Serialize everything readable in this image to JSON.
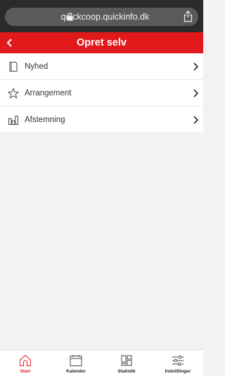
{
  "browser": {
    "url": "quickcoop.quickinfo.dk"
  },
  "header": {
    "title": "Opret selv",
    "color": "#e2191b"
  },
  "menu": {
    "items": [
      {
        "label": "Nyhed",
        "icon": "document-icon"
      },
      {
        "label": "Arrangement",
        "icon": "star-icon"
      },
      {
        "label": "Afstemning",
        "icon": "poll-icon"
      }
    ]
  },
  "tabs": [
    {
      "label": "Start",
      "icon": "home-icon",
      "active": true
    },
    {
      "label": "Kalender",
      "icon": "calendar-icon",
      "active": false
    },
    {
      "label": "Statistik",
      "icon": "statistics-icon",
      "active": false
    },
    {
      "label": "Indstillinger",
      "icon": "settings-sliders-icon",
      "active": false
    }
  ]
}
